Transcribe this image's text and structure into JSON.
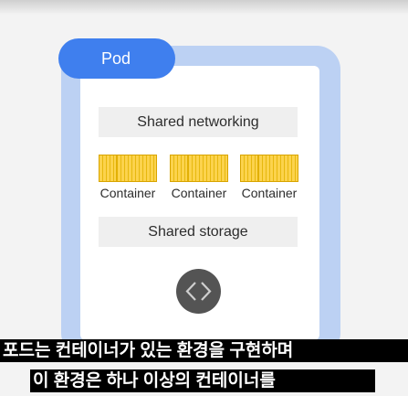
{
  "pod": {
    "label": "Pod"
  },
  "networking": {
    "label": "Shared networking"
  },
  "containers": [
    {
      "label": "Container"
    },
    {
      "label": "Container"
    },
    {
      "label": "Container"
    }
  ],
  "storage": {
    "label": "Shared storage"
  },
  "code_button": {
    "icon": "code-icon"
  },
  "subtitles": {
    "line1": "포드는 컨테이너가 있는 환경을 구현하며",
    "line2": "이 환경은 하나 이상의 컨테이너를"
  },
  "colors": {
    "pill": "#3f7fee",
    "frame": "#bcd1f3",
    "container": "#fcd34d",
    "band": "#efefef"
  }
}
